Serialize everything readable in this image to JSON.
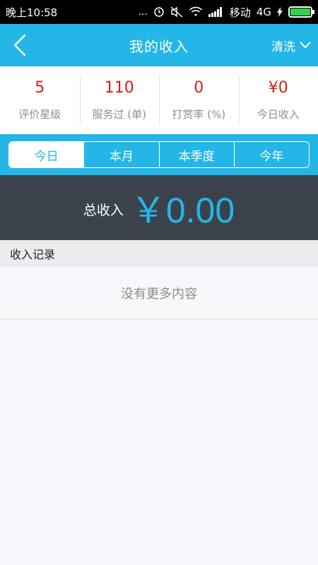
{
  "status_bar": {
    "time": "晚上10:58",
    "carrier": "移动",
    "network": "4G",
    "dots": "...",
    "icons": [
      "alarm-icon",
      "mute-icon",
      "wifi-icon",
      "signal-icon",
      "battery-icon"
    ],
    "battery_level_percent": 100
  },
  "header": {
    "title": "我的收入",
    "category": "清洗",
    "bg_color": "#24b6e6"
  },
  "stats": [
    {
      "value": "5",
      "label": "评价星级"
    },
    {
      "value": "110",
      "label": "服务过 (单)"
    },
    {
      "value": "0",
      "label": "打赏率 (%)"
    },
    {
      "value": "¥0",
      "label": "今日收入"
    }
  ],
  "tabs": [
    {
      "label": "今日",
      "active": true
    },
    {
      "label": "本月",
      "active": false
    },
    {
      "label": "本季度",
      "active": false
    },
    {
      "label": "今年",
      "active": false
    }
  ],
  "total": {
    "label": "总收入",
    "amount": "￥0.00"
  },
  "records": {
    "title": "收入记录",
    "empty_text": "没有更多内容"
  }
}
